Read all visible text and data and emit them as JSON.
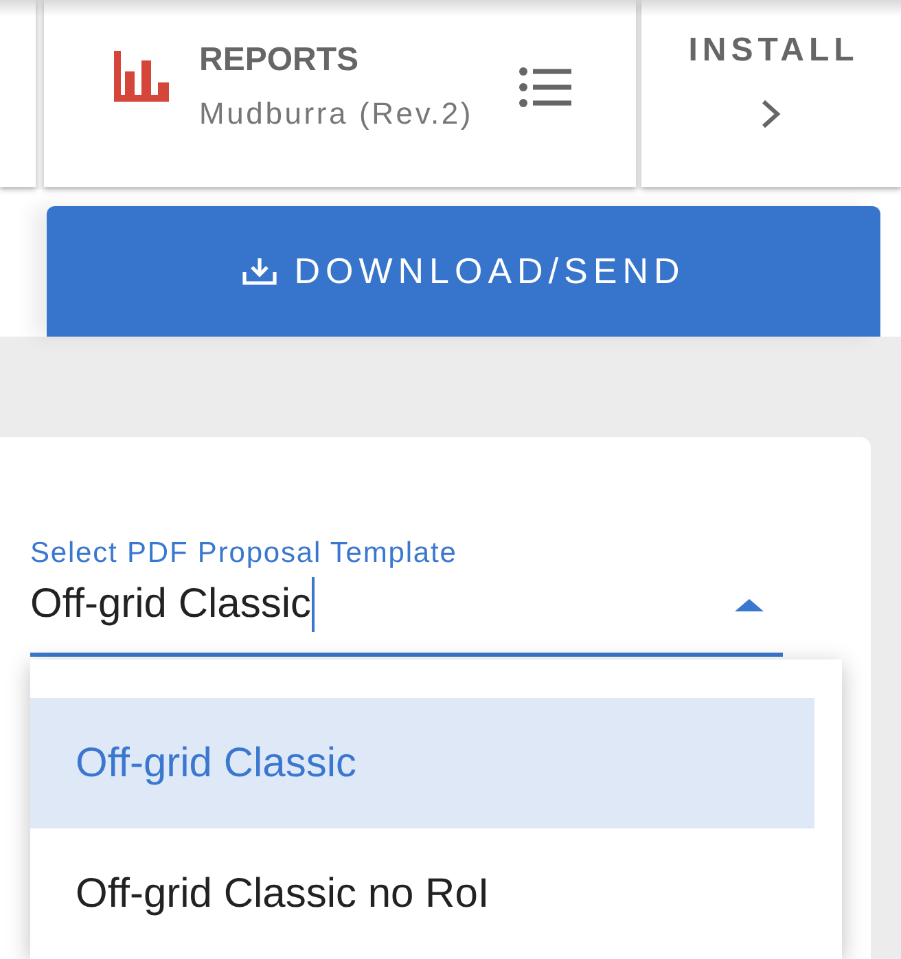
{
  "top_nav": {
    "reports": {
      "title": "REPORTS",
      "subtitle": "Mudburra (Rev.2)"
    },
    "next_step": {
      "label": "INSTALL"
    }
  },
  "download_button": {
    "label": "DOWNLOAD/SEND"
  },
  "template_select": {
    "label": "Select PDF Proposal Template",
    "value": "Off-grid Classic",
    "focused": true,
    "expanded": true,
    "options": [
      {
        "label": "Off-grid Classic",
        "selected": true
      },
      {
        "label": "Off-grid Classic no RoI",
        "selected": false
      }
    ]
  }
}
